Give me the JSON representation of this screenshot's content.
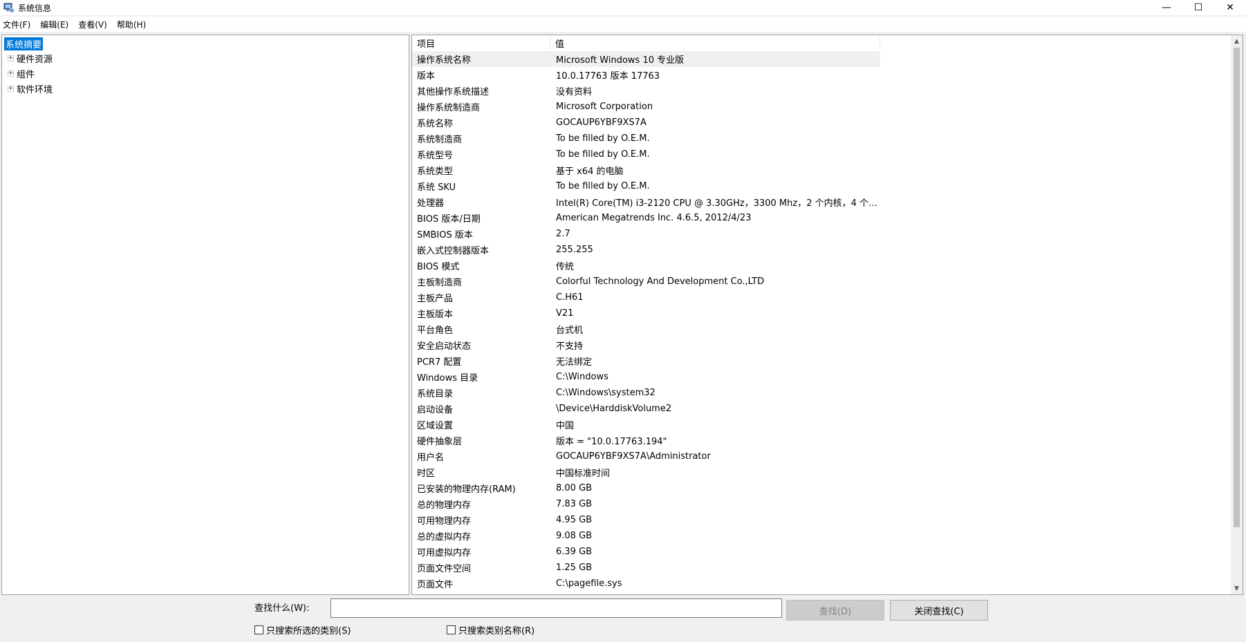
{
  "window": {
    "title": "系统信息",
    "controls": {
      "minimize": "—",
      "maximize": "☐",
      "close": "✕"
    }
  },
  "menu": [
    "文件(F)",
    "编辑(E)",
    "查看(V)",
    "帮助(H)"
  ],
  "tree": {
    "selected": "系统摘要",
    "children": [
      "硬件资源",
      "组件",
      "软件环境"
    ],
    "expander": "+"
  },
  "list": {
    "headers": {
      "item": "项目",
      "value": "值"
    },
    "rows": [
      {
        "item": "操作系统名称",
        "value": "Microsoft Windows 10 专业版"
      },
      {
        "item": "版本",
        "value": "10.0.17763 版本 17763"
      },
      {
        "item": "其他操作系统描述",
        "value": "没有资料"
      },
      {
        "item": "操作系统制造商",
        "value": "Microsoft Corporation"
      },
      {
        "item": "系统名称",
        "value": "GOCAUP6YBF9XS7A"
      },
      {
        "item": "系统制造商",
        "value": "To be filled by O.E.M."
      },
      {
        "item": "系统型号",
        "value": "To be filled by O.E.M."
      },
      {
        "item": "系统类型",
        "value": "基于 x64 的电脑"
      },
      {
        "item": "系统 SKU",
        "value": "To be filled by O.E.M."
      },
      {
        "item": "处理器",
        "value": "Intel(R) Core(TM) i3-2120 CPU @ 3.30GHz，3300 Mhz，2 个内核，4 个逻..."
      },
      {
        "item": "BIOS 版本/日期",
        "value": "American Megatrends Inc. 4.6.5, 2012/4/23"
      },
      {
        "item": "SMBIOS 版本",
        "value": "2.7"
      },
      {
        "item": "嵌入式控制器版本",
        "value": "255.255"
      },
      {
        "item": "BIOS 模式",
        "value": "传统"
      },
      {
        "item": "主板制造商",
        "value": "Colorful Technology And Development Co.,LTD"
      },
      {
        "item": "主板产品",
        "value": "C.H61"
      },
      {
        "item": "主板版本",
        "value": "V21"
      },
      {
        "item": "平台角色",
        "value": "台式机"
      },
      {
        "item": "安全启动状态",
        "value": "不支持"
      },
      {
        "item": "PCR7 配置",
        "value": "无法绑定"
      },
      {
        "item": "Windows 目录",
        "value": "C:\\Windows"
      },
      {
        "item": "系统目录",
        "value": "C:\\Windows\\system32"
      },
      {
        "item": "启动设备",
        "value": "\\Device\\HarddiskVolume2"
      },
      {
        "item": "区域设置",
        "value": "中国"
      },
      {
        "item": "硬件抽象层",
        "value": "版本 = \"10.0.17763.194\""
      },
      {
        "item": "用户名",
        "value": "GOCAUP6YBF9XS7A\\Administrator"
      },
      {
        "item": "时区",
        "value": "中国标准时间"
      },
      {
        "item": "已安装的物理内存(RAM)",
        "value": "8.00 GB"
      },
      {
        "item": "总的物理内存",
        "value": "7.83 GB"
      },
      {
        "item": "可用物理内存",
        "value": "4.95 GB"
      },
      {
        "item": "总的虚拟内存",
        "value": "9.08 GB"
      },
      {
        "item": "可用虚拟内存",
        "value": "6.39 GB"
      },
      {
        "item": "页面文件空间",
        "value": "1.25 GB"
      },
      {
        "item": "页面文件",
        "value": "C:\\pagefile.sys"
      }
    ]
  },
  "find": {
    "label": "查找什么(W):",
    "value": "",
    "find_button": "查找(D)",
    "close_button": "关闭查找(C)",
    "check_selected": "只搜索所选的类别(S)",
    "check_names": "只搜索类别名称(R)"
  },
  "colors": {
    "selection": "#0078d7",
    "first_row": "#f0f0f0"
  }
}
